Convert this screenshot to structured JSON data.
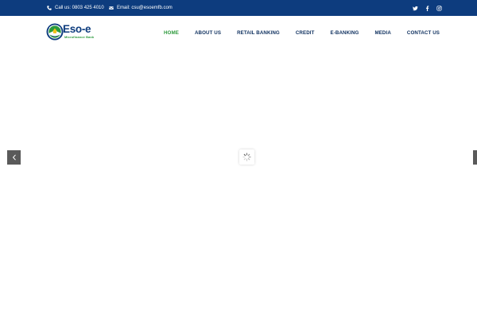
{
  "topbar": {
    "phone_text": "Call us: 0803 425 4010",
    "email_text": "Email: csu@esoemfb.com",
    "icons": {
      "phone": "phone-icon",
      "email": "envelope-icon"
    },
    "social": [
      "twitter-icon",
      "facebook-icon",
      "instagram-icon"
    ],
    "background": "#0d3c7e"
  },
  "logo": {
    "name": "Eso-e",
    "tagline": "Microfinance Bank",
    "colors": {
      "primary": "#0d3c7e",
      "accent": "#2a9a3b"
    }
  },
  "nav": {
    "items": [
      {
        "label": "HOME",
        "active": true
      },
      {
        "label": "ABOUT US",
        "active": false
      },
      {
        "label": "RETAIL BANKING",
        "active": false
      },
      {
        "label": "CREDIT",
        "active": false
      },
      {
        "label": "E-BANKING",
        "active": false
      },
      {
        "label": "MEDIA",
        "active": false
      },
      {
        "label": "CONTACT US",
        "active": false
      }
    ],
    "active_color": "#2e9a3d",
    "text_color": "#0d2f5e"
  },
  "slider": {
    "prev_icon": "chevron-left-icon",
    "next_icon": "chevron-right-icon",
    "loader_icon": "spinner-icon"
  }
}
